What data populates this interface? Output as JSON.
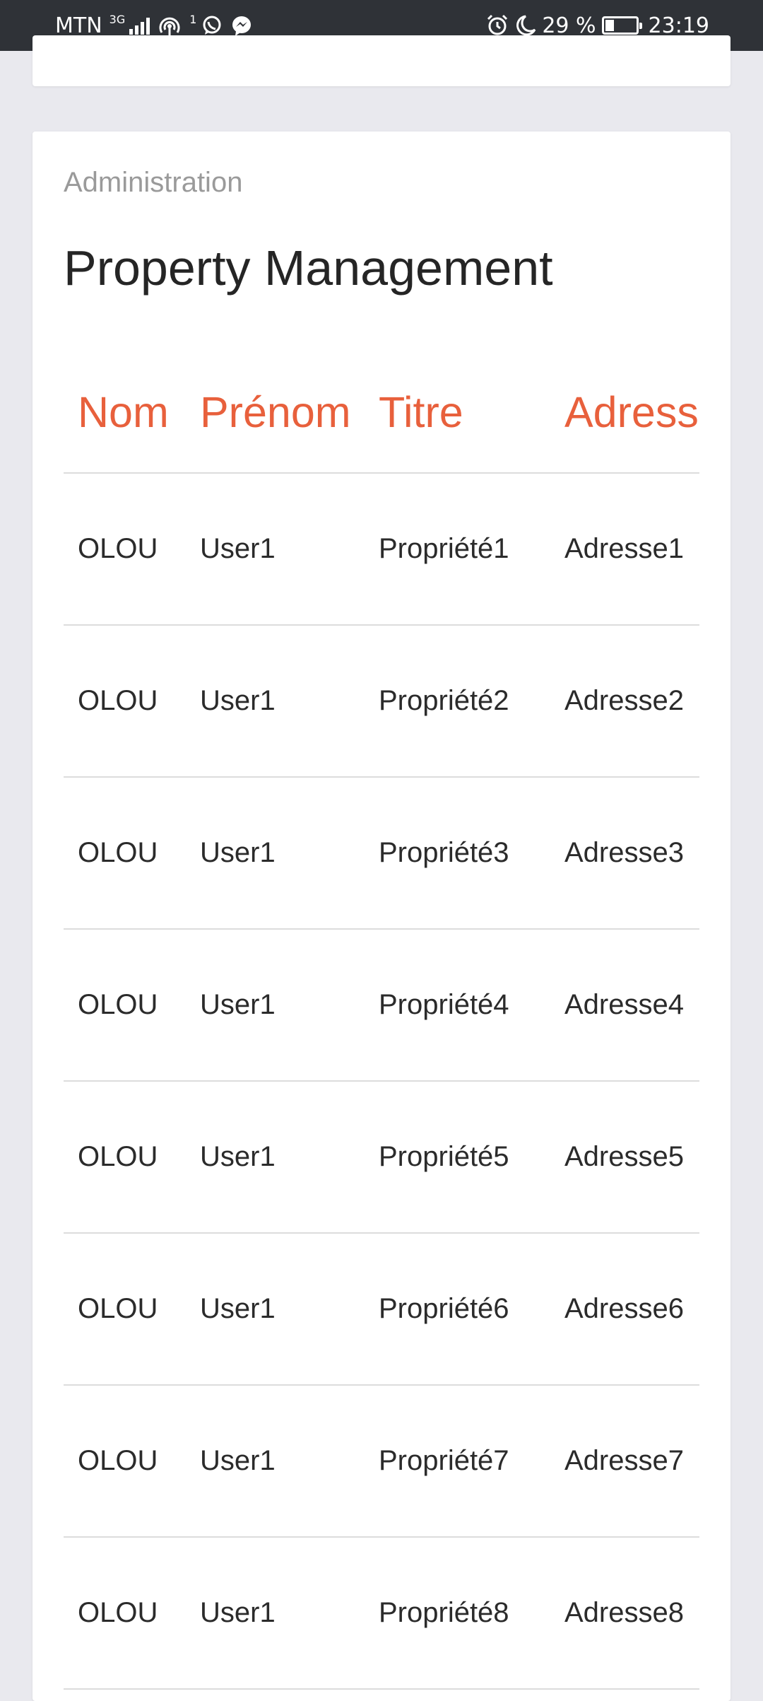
{
  "status_bar": {
    "carrier": "MTN",
    "network_type": "3G",
    "hotspot_count": "1",
    "icons": [
      "signal-icon",
      "hotspot-icon",
      "whatsapp-icon",
      "messenger-icon",
      "alarm-icon",
      "moon-icon",
      "battery-icon"
    ],
    "battery_percent": "29 %",
    "battery_level": 0.29,
    "time": "23:19"
  },
  "page": {
    "category": "Administration",
    "title": "Property Management"
  },
  "table": {
    "headers": [
      "Nom",
      "Prénom",
      "Titre",
      "Adresse"
    ],
    "rows": [
      [
        "OLOU",
        "User1",
        "Propriété1",
        "Adresse1"
      ],
      [
        "OLOU",
        "User1",
        "Propriété2",
        "Adresse2"
      ],
      [
        "OLOU",
        "User1",
        "Propriété3",
        "Adresse3"
      ],
      [
        "OLOU",
        "User1",
        "Propriété4",
        "Adresse4"
      ],
      [
        "OLOU",
        "User1",
        "Propriété5",
        "Adresse5"
      ],
      [
        "OLOU",
        "User1",
        "Propriété6",
        "Adresse6"
      ],
      [
        "OLOU",
        "User1",
        "Propriété7",
        "Adresse7"
      ],
      [
        "OLOU",
        "User1",
        "Propriété8",
        "Adresse8"
      ]
    ]
  },
  "colors": {
    "accent": "#e8603c",
    "status_bar": "#2f3237",
    "background": "#e9e9ee",
    "card": "#ffffff",
    "text": "#2b2b2b",
    "muted": "#9a9a9a"
  }
}
